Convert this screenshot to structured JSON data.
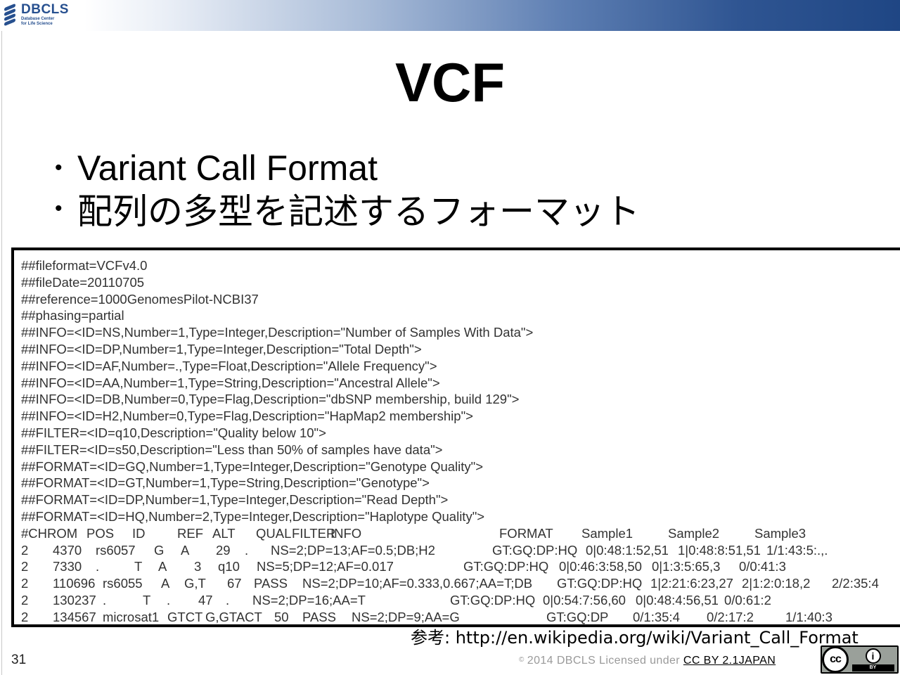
{
  "header": {
    "logo_name": "DBCLS",
    "logo_sub_line1": "Database Center",
    "logo_sub_line2": "for Life Science"
  },
  "slide": {
    "title": "VCF",
    "bullet_marker": "•",
    "bullets": [
      "Variant Call Format",
      "配列の多型を記述するフォーマット"
    ]
  },
  "vcf": {
    "meta_lines": [
      "##fileformat=VCFv4.0",
      "##fileDate=20110705",
      "##reference=1000GenomesPilot-NCBI37",
      "##phasing=partial",
      "##INFO=<ID=NS,Number=1,Type=Integer,Description=\"Number of Samples With Data\">",
      "##INFO=<ID=DP,Number=1,Type=Integer,Description=\"Total Depth\">",
      "##INFO=<ID=AF,Number=.,Type=Float,Description=\"Allele Frequency\">",
      "##INFO=<ID=AA,Number=1,Type=String,Description=\"Ancestral Allele\">",
      "##INFO=<ID=DB,Number=0,Type=Flag,Description=\"dbSNP membership, build 129\">",
      "##INFO=<ID=H2,Number=0,Type=Flag,Description=\"HapMap2 membership\">",
      "##FILTER=<ID=q10,Description=\"Quality below 10\">",
      "##FILTER=<ID=s50,Description=\"Less than 50% of samples have data\">",
      "##FORMAT=<ID=GQ,Number=1,Type=Integer,Description=\"Genotype Quality\">",
      "##FORMAT=<ID=GT,Number=1,Type=String,Description=\"Genotype\">",
      "##FORMAT=<ID=DP,Number=1,Type=Integer,Description=\"Read Depth\">",
      "##FORMAT=<ID=HQ,Number=2,Type=Integer,Description=\"Haplotype Quality\">"
    ],
    "header_row": {
      "chrom": "#CHROM",
      "pos": "POS",
      "id": "ID",
      "ref": "REF",
      "alt": "ALT",
      "qual": "QUAL",
      "filter": "FILTER",
      "info": "INFO",
      "format": "FORMAT",
      "sample1": "Sample1",
      "sample2": "Sample2",
      "sample3": "Sample3"
    },
    "records": [
      {
        "chrom": "2",
        "pos": "4370",
        "id": "rs6057",
        "ref": "G",
        "alt": "A",
        "qual": "29",
        "filter": ".",
        "info": "NS=2;DP=13;AF=0.5;DB;H2",
        "format": "GT:GQ:DP:HQ",
        "sample1": "0|0:48:1:52,51",
        "sample2": "1|0:48:8:51,51",
        "sample3": "1/1:43:5:.,."
      },
      {
        "chrom": "2",
        "pos": "7330",
        "id": ".",
        "ref": "T",
        "alt": "A",
        "qual": "3",
        "filter": "q10",
        "info": "NS=5;DP=12;AF=0.017",
        "format": "GT:GQ:DP:HQ",
        "sample1": "0|0:46:3:58,50",
        "sample2": "0|1:3:5:65,3",
        "sample3": "0/0:41:3"
      },
      {
        "chrom": "2",
        "pos": "110696",
        "id": "rs6055",
        "ref": "A",
        "alt": "G,T",
        "qual": "67",
        "filter": "PASS",
        "info": "NS=2;DP=10;AF=0.333,0.667;AA=T;DB",
        "format": "GT:GQ:DP:HQ",
        "sample1": "1|2:21:6:23,27",
        "sample2": "2|1:2:0:18,2",
        "sample3": "2/2:35:4"
      },
      {
        "chrom": "2",
        "pos": "130237",
        "id": ".",
        "ref": "T",
        "alt": ".",
        "qual": "47",
        "filter": ".",
        "info": "NS=2;DP=16;AA=T",
        "format": "GT:GQ:DP:HQ",
        "sample1": "0|0:54:7:56,60",
        "sample2": "0|0:48:4:56,51",
        "sample3": "0/0:61:2"
      },
      {
        "chrom": "2",
        "pos": "134567",
        "id": "microsat1",
        "ref": "GTCT",
        "alt": "G,GTACT",
        "qual": "50",
        "filter": "PASS",
        "info": "NS=2;DP=9;AA=G",
        "format": "GT:GQ:DP",
        "sample1": "0/1:35:4",
        "sample2": "0/2:17:2",
        "sample3": "1/1:40:3"
      }
    ]
  },
  "footer": {
    "reference": "参考: http://en.wikipedia.org/wiki/Variant_Call_Format",
    "page_number": "31",
    "copyright_symbol": "©",
    "copyright_text": "2014 DBCLS Licensed under ",
    "license_link": "CC BY 2.1JAPAN",
    "cc_label": "cc",
    "by_symbol": "i",
    "by_label": "BY"
  }
}
